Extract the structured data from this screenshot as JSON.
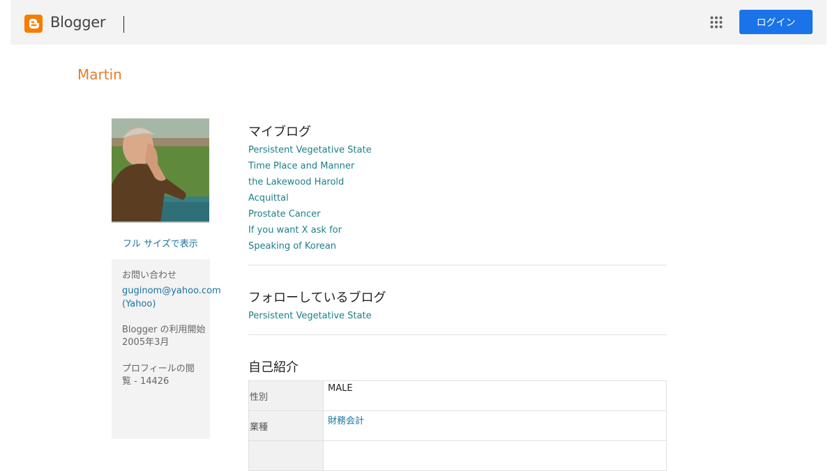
{
  "header": {
    "logo_text": "Blogger",
    "login_label": "ログイン",
    "brand_color": "#f57d00",
    "login_bg": "#1a73e8",
    "apps_icon": "apps-grid-icon"
  },
  "profile": {
    "name": "Martin",
    "full_size_label": "フル サイズで表示"
  },
  "sidebar": {
    "contact_label": "お問い合わせ",
    "contact_email": "guginom@yahoo.com",
    "contact_service": "(Yahoo)",
    "since_label": "Blogger の利用開始",
    "since_value": "2005年3月",
    "views_label_line1": "プロフィールの閲",
    "views_label_line2": "覧 - 14426"
  },
  "my_blogs": {
    "title": "マイブログ",
    "items": [
      "Persistent Vegetative State",
      "Time Place and Manner",
      "the Lakewood Harold",
      "Acquittal",
      "Prostate Cancer",
      "If you want X ask for",
      "Speaking of Korean"
    ]
  },
  "following": {
    "title": "フォローしているブログ",
    "items": [
      "Persistent Vegetative State"
    ]
  },
  "about": {
    "title": "自己紹介",
    "rows": [
      {
        "label": "性別",
        "value": "MALE"
      },
      {
        "label": "業種",
        "value": "財務会計"
      }
    ]
  }
}
